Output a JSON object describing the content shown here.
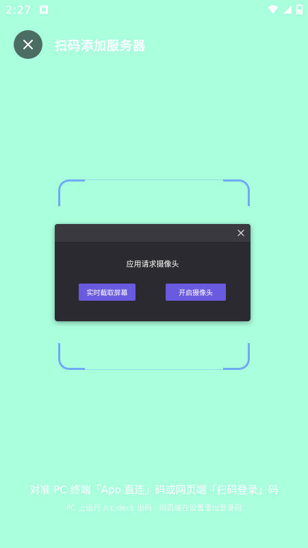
{
  "status_bar": {
    "time": "2:27",
    "icons": [
      "notification-icon",
      "wifi-icon",
      "signal-icon",
      "battery-icon"
    ]
  },
  "header": {
    "close_icon": "close-icon",
    "title": "扫码添加服务器"
  },
  "dialog": {
    "message": "应用请求摄像头",
    "capture_screen_label": "实时截取屏幕",
    "open_camera_label": "开启摄像头",
    "close_icon": "close-icon"
  },
  "hints": {
    "main": "对准 PC 终端「App 直连」码或网页端「扫码登录」码",
    "sub": "PC 上运行 /cc:deck 出码 · 网页端在设置里出登录码"
  },
  "colors": {
    "background": "#aaffdc",
    "close_button": "#4b6d63",
    "scan_frame": "#6eaaf3",
    "dialog_bg": "#2b2a31",
    "dialog_button": "#6a5ae0"
  }
}
